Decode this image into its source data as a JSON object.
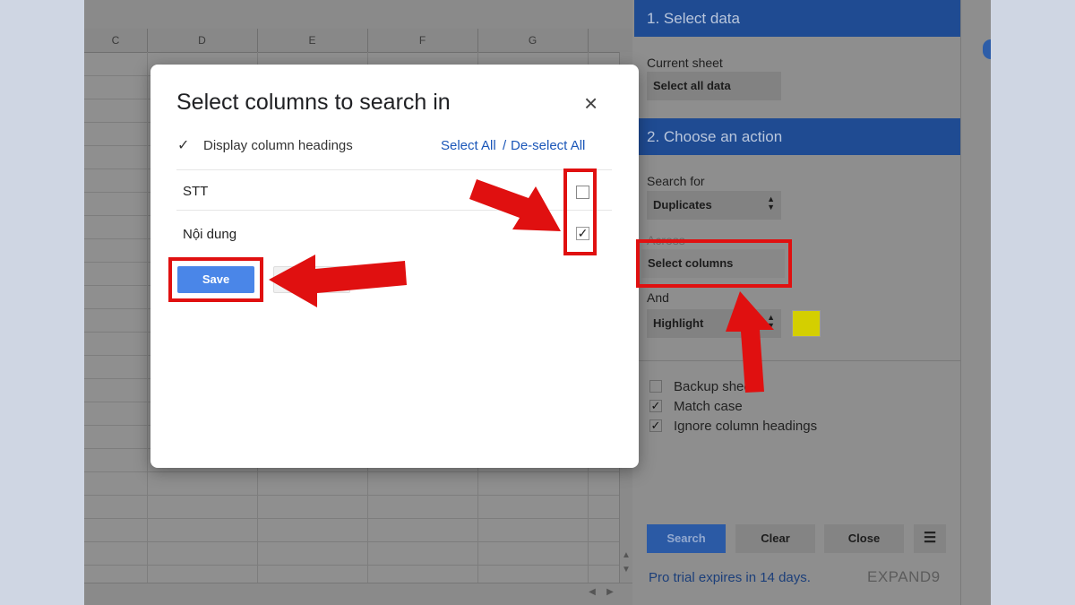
{
  "sheet": {
    "columns": [
      "C",
      "D",
      "E",
      "F",
      "G"
    ]
  },
  "dialog": {
    "title": "Select columns to search in",
    "close_icon": "×",
    "display_headings_label": "Display column headings",
    "display_headings_checked": true,
    "select_all": "Select All",
    "separator": "/",
    "deselect_all": "De-select All",
    "columns": [
      {
        "label": "STT",
        "checked": false
      },
      {
        "label": "Nội dung",
        "checked": true
      }
    ],
    "save_label": "Save",
    "cancel_label": ""
  },
  "panel": {
    "section1_title": "1. Select data",
    "current_sheet_label": "Current sheet",
    "select_all_data": "Select all data",
    "section2_title": "2. Choose an action",
    "search_for_label": "Search for",
    "search_for_value": "Duplicates",
    "across_label": "Across",
    "across_value": "Select columns",
    "and_label": "And",
    "and_value": "Highlight",
    "highlight_color": "#d4cf00",
    "options": [
      {
        "label": "Backup sheet",
        "checked": false
      },
      {
        "label": "Match case",
        "checked": true
      },
      {
        "label": "Ignore column headings",
        "checked": true
      }
    ],
    "search_button": "Search",
    "clear_button": "Clear",
    "close_button": "Close",
    "menu_icon": "☰",
    "trial_text": "Pro trial expires in 14 days.",
    "brand": "EXPAND9"
  },
  "colors": {
    "accent": "#4a86e8",
    "header_blue": "#1f4b92",
    "annotation_red": "#e01010"
  }
}
